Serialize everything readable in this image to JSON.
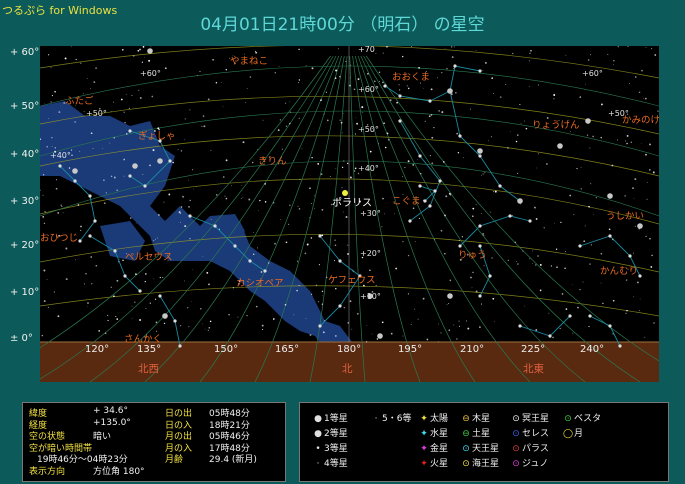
{
  "app_title": "つるぷら for Windows",
  "view_title": "04月01日21時00分 （明石） の星空",
  "colors": {
    "background": "#0d5a5a",
    "sky": "#000000",
    "milky_way": "#1a3a78",
    "horizon": "#5a2a10",
    "constellation_label": "#e86a20",
    "grid": "#2a7a50",
    "dec_circle": "#a0a020"
  },
  "dec_axis_labels": [
    {
      "text": "+ 60°",
      "dec": 60
    },
    {
      "text": "+ 50°",
      "dec": 50
    },
    {
      "text": "+ 40°",
      "dec": 40
    },
    {
      "text": "+ 30°",
      "dec": 30
    },
    {
      "text": "+ 20°",
      "dec": 20
    },
    {
      "text": "+ 10°",
      "dec": 10
    },
    {
      "text": "± 0°",
      "dec": 0
    }
  ],
  "azimuth_labels": [
    "120°",
    "135°",
    "150°",
    "165°",
    "180°",
    "195°",
    "210°",
    "225°",
    "240°"
  ],
  "directions": [
    "北西",
    "北",
    "北東"
  ],
  "grid_labels": [
    "+70",
    "+60°",
    "+60°",
    "+60°",
    "+50°",
    "+50°",
    "+50°",
    "+40°",
    "+40°",
    "+30°",
    "+20°",
    "+10°"
  ],
  "constellations": [
    "やまねこ",
    "おおくま",
    "ふたご",
    "きりん",
    "りょうけん",
    "かみのけ",
    "ぎょしゃ",
    "こぐま",
    "うしかい",
    "りゅう",
    "ペルセウス",
    "カシオペア",
    "ケフェウス",
    "かんむり",
    "さんかく",
    "おひつじ"
  ],
  "star_labels": [
    "ポラリス"
  ],
  "info": {
    "rows": [
      {
        "k": "緯度",
        "v": "+ 34.6°"
      },
      {
        "k": "経度",
        "v": "+135.0°"
      },
      {
        "k": "空の状態",
        "v": "暗い"
      },
      {
        "k": "空が暗い時間帯",
        "v": ""
      },
      {
        "k": "",
        "v": "19時46分〜04時23分"
      },
      {
        "k": "表示方向",
        "v": "方位角 180°"
      }
    ],
    "rows2": [
      {
        "k": "日の出",
        "v": "05時48分"
      },
      {
        "k": "日の入",
        "v": "18時21分"
      },
      {
        "k": "月の出",
        "v": "05時46分"
      },
      {
        "k": "月の入",
        "v": "17時48分"
      },
      {
        "k": "月齢",
        "v": "29.4 (新月)"
      }
    ]
  },
  "legend": [
    {
      "sym": "●",
      "color": "#e0e0e0",
      "label": "1等星"
    },
    {
      "sym": "●",
      "color": "#e0e0e0",
      "label": "2等星"
    },
    {
      "sym": "•",
      "color": "#e0e0e0",
      "label": "3等星"
    },
    {
      "sym": "·",
      "color": "#e0e0e0",
      "label": "4等星"
    },
    {
      "sym": "·",
      "color": "#e0e0e0",
      "label": "5・6等"
    },
    {
      "sym": "✦",
      "color": "#f0e040",
      "label": "太陽"
    },
    {
      "sym": "✦",
      "color": "#40e0f0",
      "label": "水星"
    },
    {
      "sym": "✦",
      "color": "#e040e0",
      "label": "金星"
    },
    {
      "sym": "✦",
      "color": "#e02020",
      "label": "火星"
    },
    {
      "sym": "⊖",
      "color": "#f0c040",
      "label": "木星"
    },
    {
      "sym": "⊖",
      "color": "#40d040",
      "label": "土星"
    },
    {
      "sym": "⊙",
      "color": "#40e0f0",
      "label": "天王星"
    },
    {
      "sym": "⊙",
      "color": "#f0e040",
      "label": "海王星"
    },
    {
      "sym": "⊙",
      "color": "#f0f0f0",
      "label": "冥王星"
    },
    {
      "sym": "⊙",
      "color": "#4060f0",
      "label": "セレス"
    },
    {
      "sym": "⊙",
      "color": "#e04040",
      "label": "パラス"
    },
    {
      "sym": "⊙",
      "color": "#e040e0",
      "label": "ジュノ"
    },
    {
      "sym": "⊙",
      "color": "#40d040",
      "label": "ベスタ"
    },
    {
      "sym": "◯",
      "color": "#f0e040",
      "label": "月"
    }
  ]
}
